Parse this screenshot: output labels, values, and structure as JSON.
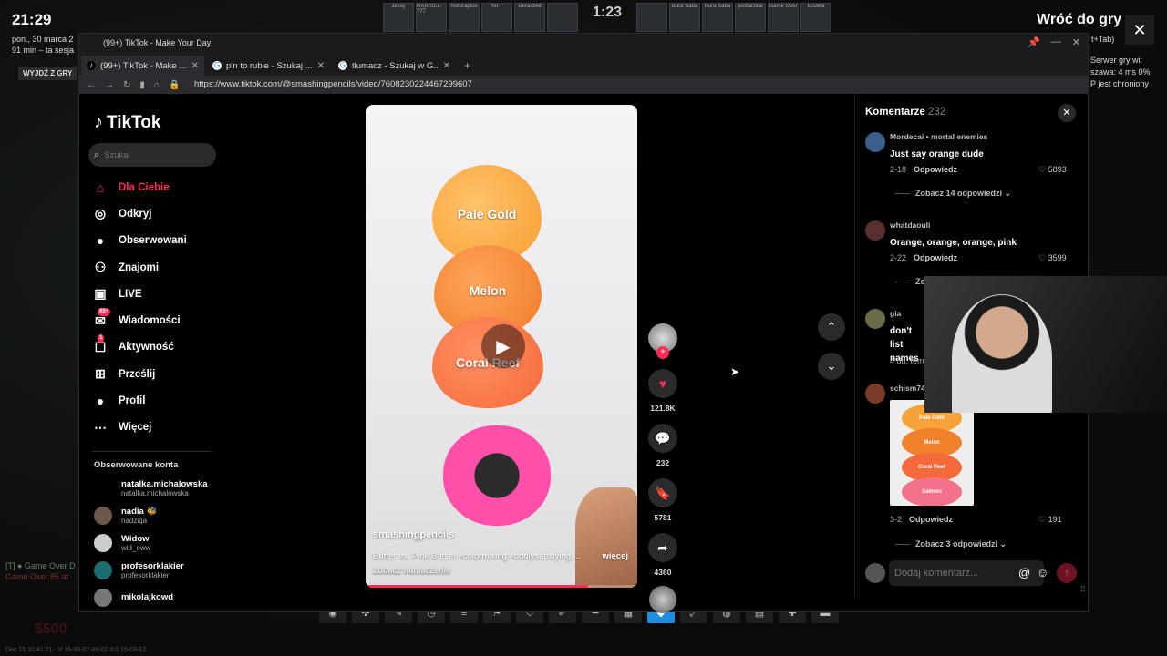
{
  "overlay": {
    "clock": "21:29",
    "date_line": "pon., 30 marca 2",
    "session_line": "91 min – ta sesja",
    "exit_game_label": "WYJDŹ Z GRY",
    "return_label": "Wróć do gry",
    "close_icon": "close-icon",
    "shortcut_hint": "t+Tab)",
    "server_line1": "Serwer gry wi:",
    "server_line2": "szawa: 4 ms 0%",
    "server_line3": "P jest chroniony",
    "hud_score": "1:23",
    "hud_names": [
      "Jessy",
      "RASHIEL-777",
      "Notoraptos",
      "YeFF",
      "Deralized",
      "",
      "",
      "Bura Saba",
      "Bura Saba",
      "postarzkal",
      "Game Over",
      "EJJeta"
    ],
    "left_status_1": "[T] ● Game Over D",
    "left_status_2": "Game Over 85 at",
    "money": "$500",
    "footer": "Dec 15 10:41:71 - V 16-05-07-00-02 0:0 15-03-12",
    "taskbar_icons": [
      "circle",
      "puzzle",
      "pen",
      "clock",
      "list",
      "flag",
      "shield",
      "brush",
      "minus",
      "grid",
      "diamond",
      "expand",
      "globe",
      "stack",
      "plus",
      "dash"
    ]
  },
  "browser": {
    "window_title": "(99+) TikTok - Make Your Day",
    "tabs": [
      {
        "label": "(99+) TikTok - Make ...",
        "favicon": "tiktok-icon"
      },
      {
        "label": "pln to ruble - Szukaj ...",
        "favicon": "google-icon"
      },
      {
        "label": "tłumacz - Szukaj w G...",
        "favicon": "google-icon"
      }
    ],
    "new_tab": "+",
    "url": "https://www.tiktok.com/@smashingpencils/video/7608230224467299607"
  },
  "tiktok": {
    "logo_text": "TikTok",
    "search_placeholder": "Szukaj",
    "nav": [
      {
        "label": "Dla Ciebie",
        "icon": "home-icon"
      },
      {
        "label": "Odkryj",
        "icon": "compass-icon"
      },
      {
        "label": "Obserwowani",
        "icon": "following-avatar-icon"
      },
      {
        "label": "Znajomi",
        "icon": "friends-icon"
      },
      {
        "label": "LIVE",
        "icon": "live-icon"
      },
      {
        "label": "Wiadomości",
        "icon": "inbox-icon",
        "badge": "99+"
      },
      {
        "label": "Aktywność",
        "icon": "activity-icon",
        "badge": "1"
      },
      {
        "label": "Prześlij",
        "icon": "upload-icon"
      },
      {
        "label": "Profil",
        "icon": "profile-icon"
      },
      {
        "label": "Więcej",
        "icon": "more-icon"
      }
    ],
    "following_header": "Obserwowane konta",
    "accounts": [
      {
        "name": "natalka.michalowska",
        "handle": "natalka.michalowska"
      },
      {
        "name": "nadia 🐝",
        "handle": "nadziqa"
      },
      {
        "name": "Widow",
        "handle": "wid_oww"
      },
      {
        "name": "profesorklakier",
        "handle": "profesorklakier"
      },
      {
        "name": "mikolajkowd",
        "handle": ""
      }
    ],
    "video": {
      "labels": [
        "Pale Gold",
        "Melon",
        "Coral Reef"
      ],
      "author": "smashingpencils",
      "description": "Butter vs. Pink Battle! #colormixing #oddlysatisfying ...",
      "more": "więcej",
      "translate": "Zobacz tłumaczenie",
      "progress": 0.82
    },
    "rail": {
      "likes": "121.8K",
      "comments": "232",
      "saves": "5781",
      "shares": "4360"
    },
    "comments_panel": {
      "title": "Komentarze",
      "count": "232",
      "items": [
        {
          "user": "Mordecai • mortal enemies",
          "text": "Just say orange dude",
          "date": "2-18",
          "reply": "Odpowiedz",
          "likes": "5893",
          "thread": "Zobacz 14 odpowiedzi"
        },
        {
          "user": "whatdaouli",
          "text": "Orange, orange, orange, pink",
          "date": "2-22",
          "reply": "Odpowiedz",
          "likes": "3599",
          "thread": "Zob"
        },
        {
          "user": "gia",
          "text": "don't list names",
          "date": "4 dn. tem",
          "reply": "",
          "likes": "",
          "thread": ""
        },
        {
          "user": "schism74",
          "text": "",
          "date": "3-2",
          "reply": "Odpowiedz",
          "likes": "191",
          "thread": "Zobacz 3 odpowiedzi"
        }
      ],
      "thumb_labels": [
        "Pale Gold",
        "Melon",
        "Coral Reef",
        "Salmon"
      ],
      "input_placeholder": "Dodaj komentarz..."
    }
  },
  "colors": {
    "accent": "#fe2c55",
    "bg": "#000000",
    "highlight": "#1d8fe0"
  }
}
